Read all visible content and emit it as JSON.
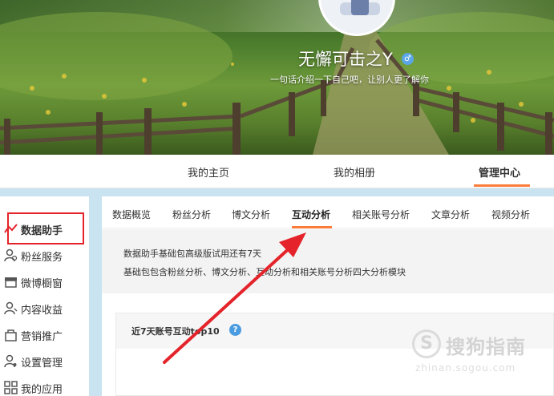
{
  "profile": {
    "name": "无懈可击之Y",
    "intro": "一句话介绍一下自己吧，让别人更了解你",
    "gender_icon": "male-icon"
  },
  "top_nav": {
    "items": [
      {
        "label": "我的主页"
      },
      {
        "label": "我的相册"
      },
      {
        "label": "管理中心",
        "active": true
      }
    ],
    "accent": "#fa7d3c"
  },
  "sidebar": {
    "items": [
      {
        "label": "数据助手",
        "icon": "chart-icon",
        "active": true
      },
      {
        "label": "粉丝服务",
        "icon": "user-service-icon"
      },
      {
        "label": "微博橱窗",
        "icon": "shop-window-icon"
      },
      {
        "label": "内容收益",
        "icon": "user-earnings-icon"
      },
      {
        "label": "营销推广",
        "icon": "bag-icon"
      },
      {
        "label": "设置管理",
        "icon": "user-settings-icon"
      },
      {
        "label": "我的应用",
        "icon": "grid-icon"
      }
    ],
    "highlight_color": "#e4232a"
  },
  "tabs": {
    "items": [
      {
        "label": "数据概览"
      },
      {
        "label": "粉丝分析"
      },
      {
        "label": "博文分析"
      },
      {
        "label": "互动分析",
        "active": true
      },
      {
        "label": "相关账号分析"
      },
      {
        "label": "文章分析"
      },
      {
        "label": "视频分析"
      }
    ]
  },
  "notice": {
    "line1": "数据助手基础包高级版试用还有7天",
    "line2": "基础包包含粉丝分析、博文分析、互动分析和相关账号分析四大分析模块"
  },
  "panel": {
    "title": "近7天账号互动top10",
    "help_icon": "question-icon"
  },
  "watermark": {
    "symbol": "S",
    "text": "搜狗指南",
    "url": "zhinan.sogou.com"
  },
  "annotation": {
    "arrow_color": "#e4232a"
  }
}
